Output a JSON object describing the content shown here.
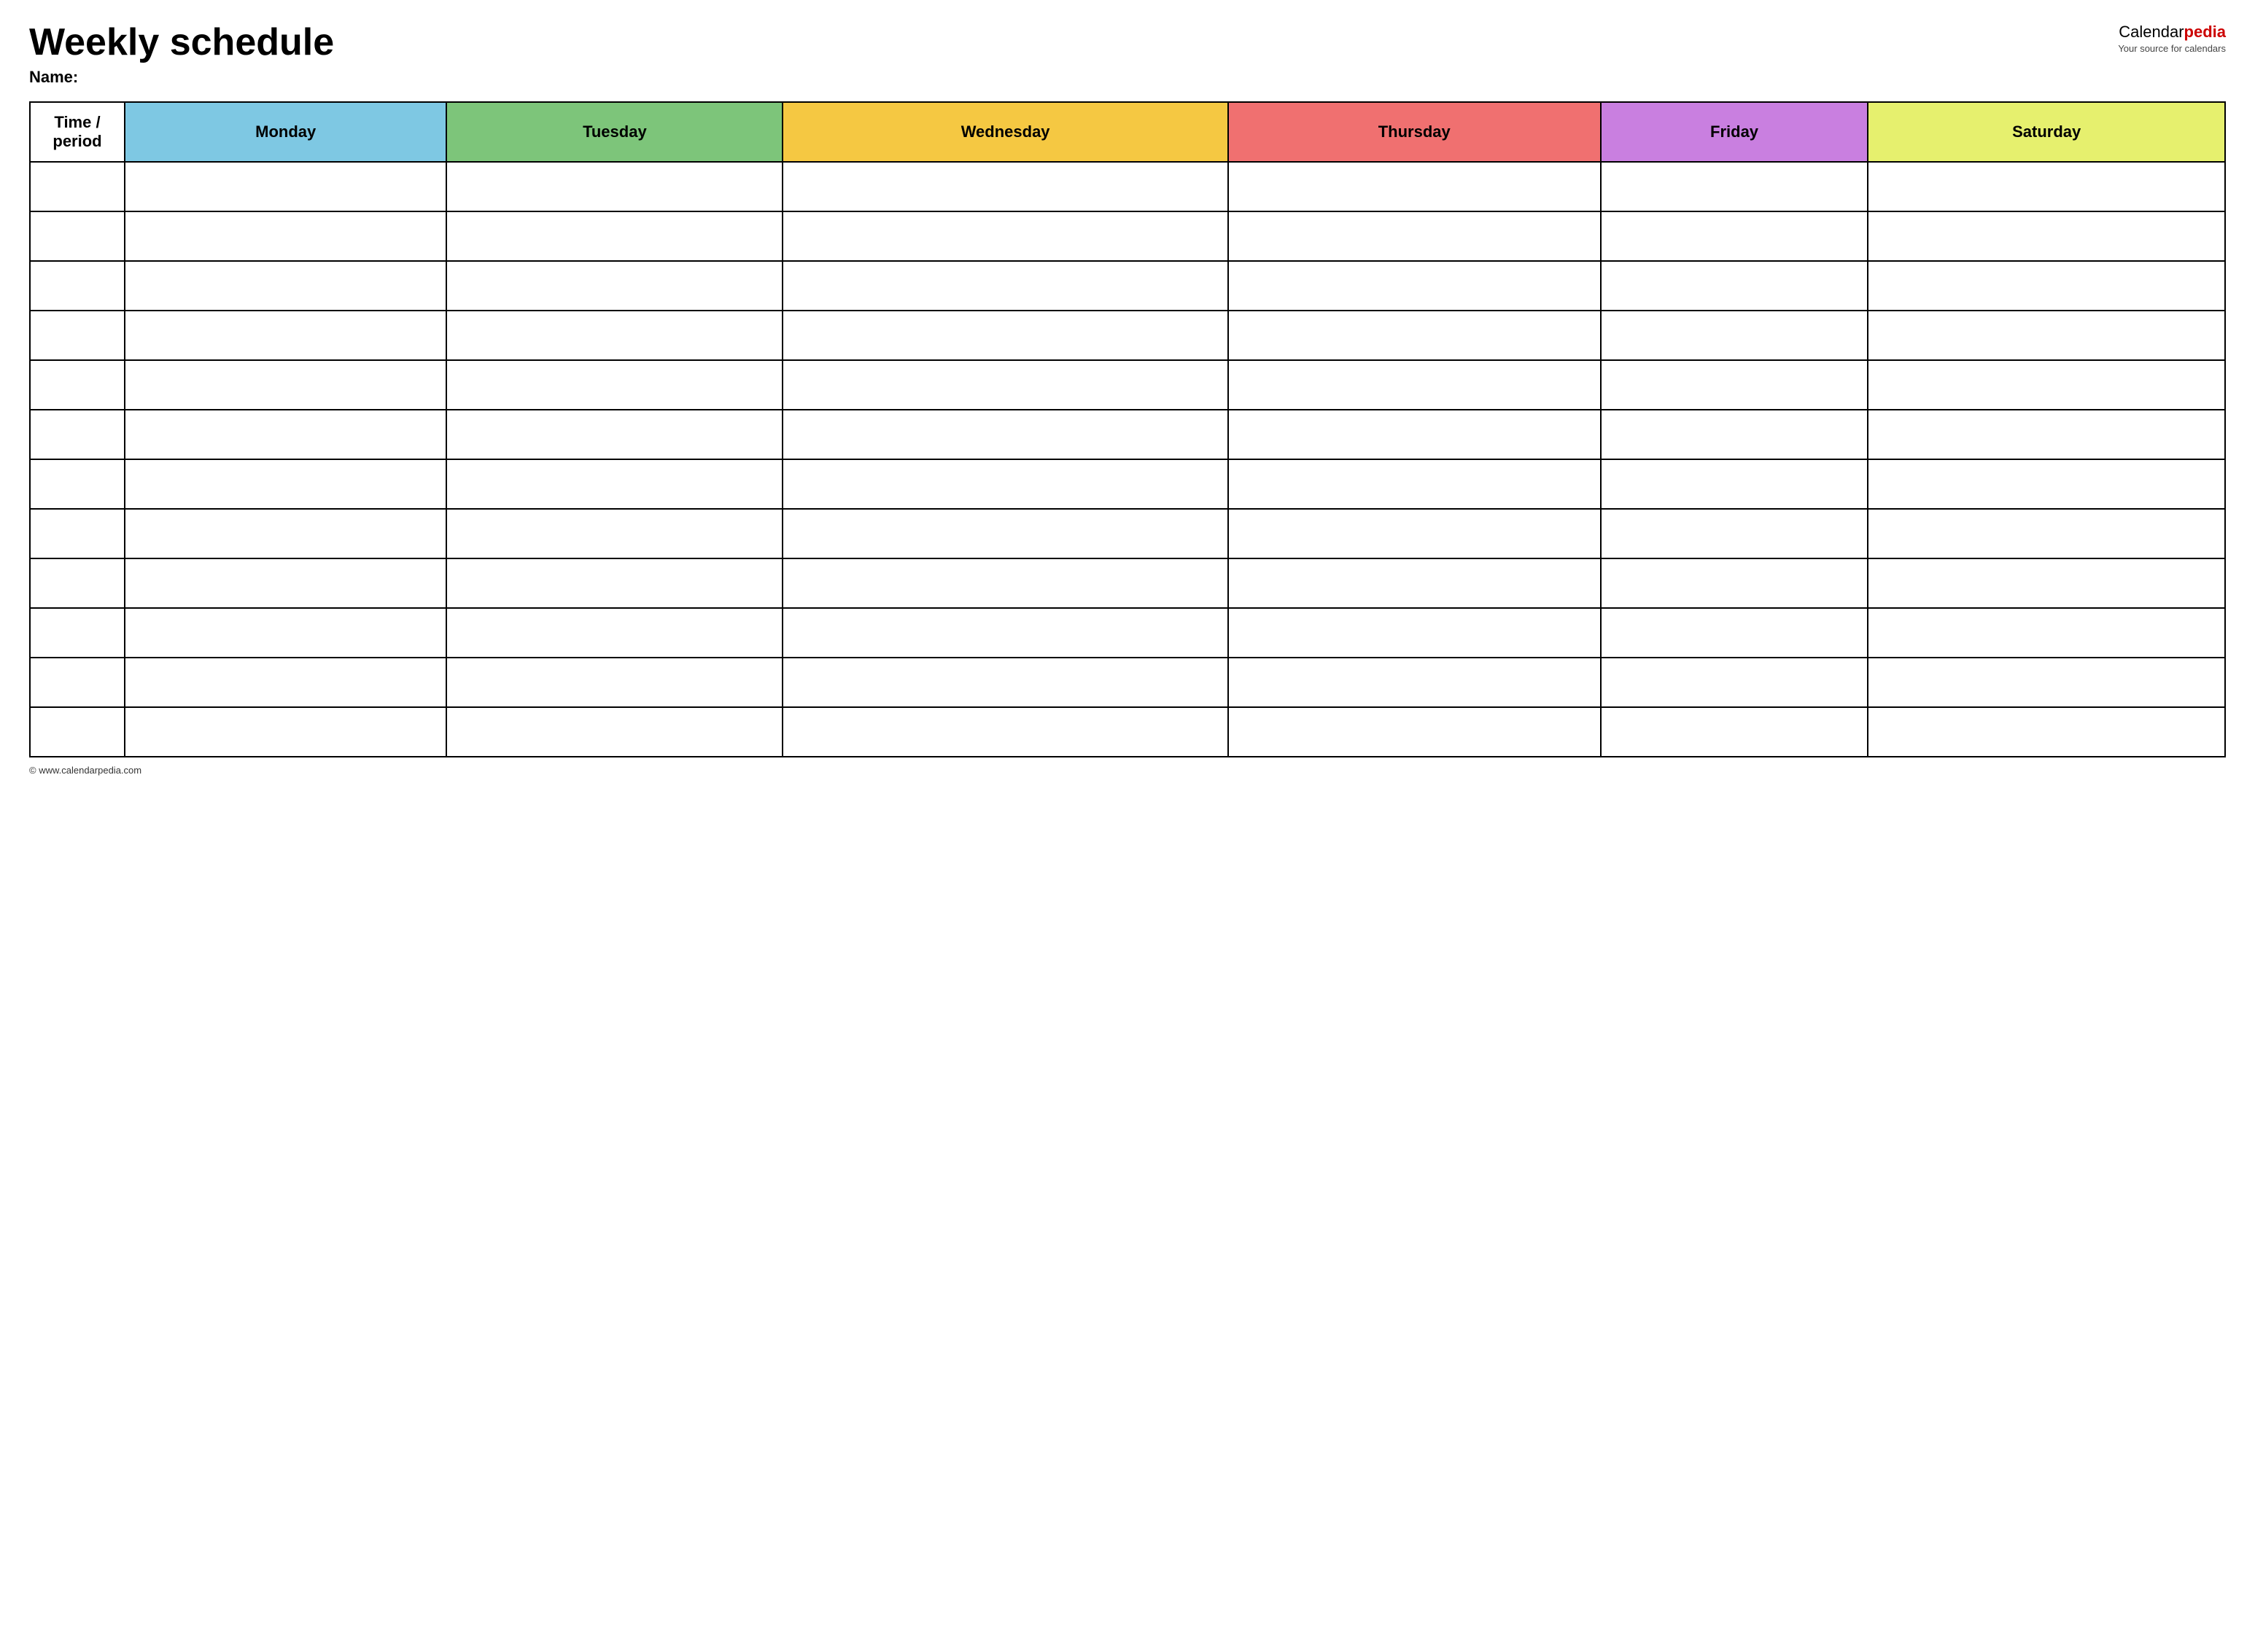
{
  "header": {
    "title": "Weekly schedule",
    "name_label": "Name:",
    "logo_calendar": "Calendar",
    "logo_pedia": "pedia",
    "logo_tagline": "Your source for calendars"
  },
  "table": {
    "columns": [
      {
        "key": "time",
        "label": "Time / period",
        "colorClass": "col-time"
      },
      {
        "key": "monday",
        "label": "Monday",
        "colorClass": "col-monday"
      },
      {
        "key": "tuesday",
        "label": "Tuesday",
        "colorClass": "col-tuesday"
      },
      {
        "key": "wednesday",
        "label": "Wednesday",
        "colorClass": "col-wednesday"
      },
      {
        "key": "thursday",
        "label": "Thursday",
        "colorClass": "col-thursday"
      },
      {
        "key": "friday",
        "label": "Friday",
        "colorClass": "col-friday"
      },
      {
        "key": "saturday",
        "label": "Saturday",
        "colorClass": "col-saturday"
      }
    ],
    "row_count": 12
  },
  "footer": {
    "url": "© www.calendarpedia.com"
  }
}
